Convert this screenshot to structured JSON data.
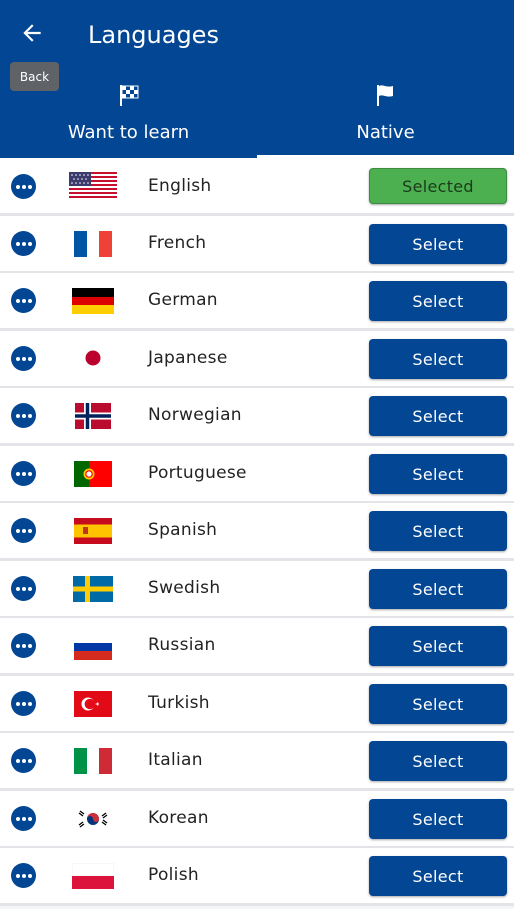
{
  "header": {
    "title": "Languages",
    "back_tooltip": "Back",
    "tabs": [
      {
        "label": "Want to learn",
        "icon": "checkered-flag-icon"
      },
      {
        "label": "Native",
        "icon": "flag-icon"
      }
    ],
    "active_tab": "Native"
  },
  "colors": {
    "primary": "#034694",
    "selected": "#4caf50"
  },
  "languages": [
    {
      "name": "English",
      "button": "Selected",
      "flag": "us-flag-icon"
    },
    {
      "name": "French",
      "button": "Select",
      "flag": "france-flag-icon"
    },
    {
      "name": "German",
      "button": "Select",
      "flag": "germany-flag-icon"
    },
    {
      "name": "Japanese",
      "button": "Select",
      "flag": "japan-flag-icon"
    },
    {
      "name": "Norwegian",
      "button": "Select",
      "flag": "norway-flag-icon"
    },
    {
      "name": "Portuguese",
      "button": "Select",
      "flag": "portugal-flag-icon"
    },
    {
      "name": "Spanish",
      "button": "Select",
      "flag": "spain-flag-icon"
    },
    {
      "name": "Swedish",
      "button": "Select",
      "flag": "sweden-flag-icon"
    },
    {
      "name": "Russian",
      "button": "Select",
      "flag": "russia-flag-icon"
    },
    {
      "name": "Turkish",
      "button": "Select",
      "flag": "turkey-flag-icon"
    },
    {
      "name": "Italian",
      "button": "Select",
      "flag": "italy-flag-icon"
    },
    {
      "name": "Korean",
      "button": "Select",
      "flag": "korea-flag-icon"
    },
    {
      "name": "Polish",
      "button": "Select",
      "flag": "poland-flag-icon"
    }
  ]
}
